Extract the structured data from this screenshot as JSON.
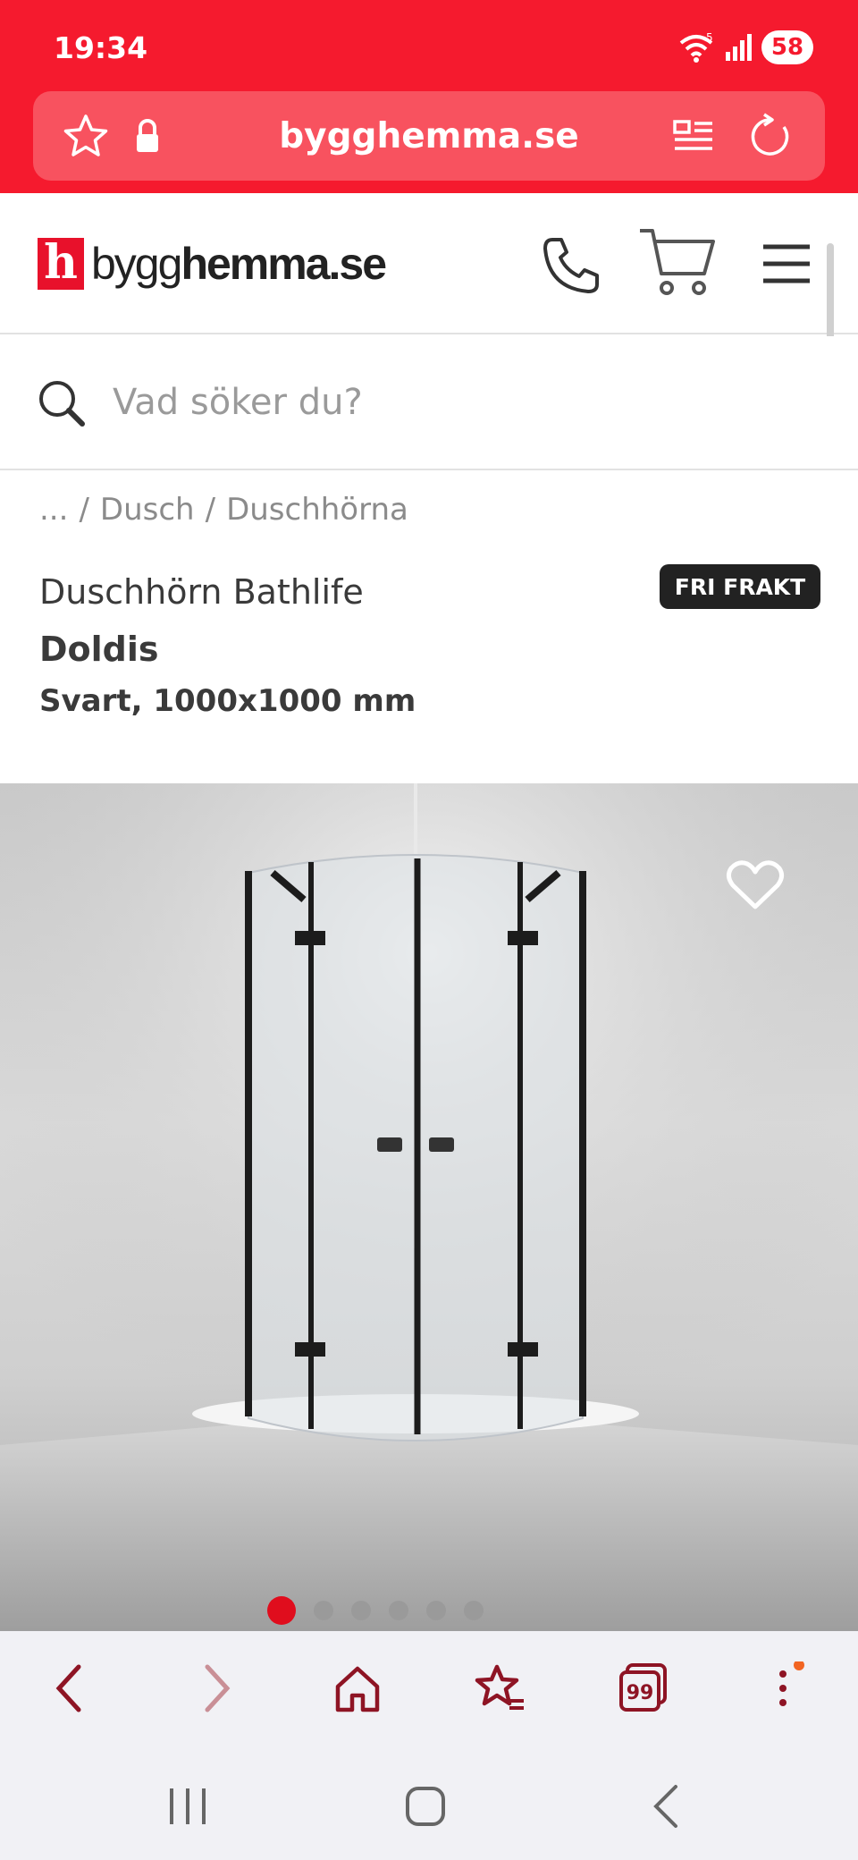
{
  "status": {
    "time": "19:34",
    "battery": "58",
    "wifi_label": "5"
  },
  "browser": {
    "url": "bygghemma.se"
  },
  "site": {
    "logo_mark": "h",
    "logo_prefix": "bygg",
    "logo_suffix": "hemma.se"
  },
  "search": {
    "placeholder": "Vad söker du?",
    "value": ""
  },
  "breadcrumb": [
    "...",
    "/",
    "Dusch",
    "/",
    "Duschhörna"
  ],
  "product": {
    "brand_line": "Duschhörn Bathlife",
    "name": "Doldis",
    "variant": "Svart, 1000x1000 mm",
    "badge": "FRI FRAKT",
    "gallery_current": 1,
    "gallery_total": 6
  },
  "bottom_toolbar": {
    "tabs_count": "99"
  },
  "colors": {
    "brand_red": "#f51a2e",
    "badge_bg": "#222222",
    "dark_red_icon": "#8e1424"
  }
}
